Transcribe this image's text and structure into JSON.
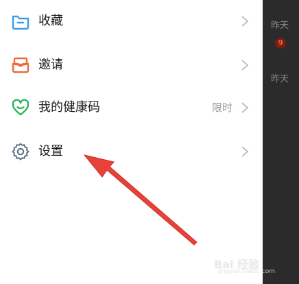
{
  "menu": {
    "items": [
      {
        "label": "收藏",
        "icon": "folder-icon",
        "color": "#3d9be9"
      },
      {
        "label": "邀请",
        "icon": "invite-box-icon",
        "color": "#ef6a3a"
      },
      {
        "label": "我的健康码",
        "icon": "heart-icon",
        "color": "#2cb35a",
        "extra": "限时"
      },
      {
        "label": "设置",
        "icon": "gear-icon",
        "color": "#5f7386"
      }
    ]
  },
  "background_chat": {
    "time_1": "昨天",
    "badge": "9",
    "time_2": "昨天"
  },
  "watermark": {
    "brand": "Bai 经验",
    "sub": "jingyan.baidu.com"
  },
  "colors": {
    "arrow": "#e8413a",
    "strip": "#2b2b2b",
    "chevron": "#b8b8b8"
  }
}
